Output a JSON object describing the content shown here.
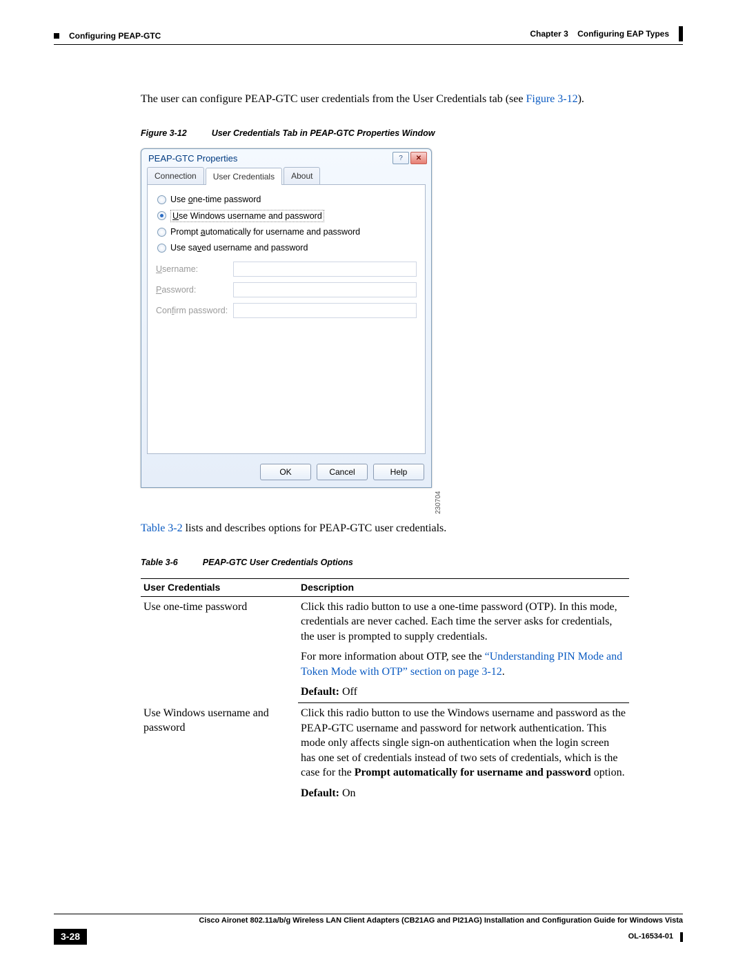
{
  "header": {
    "section": "Configuring PEAP-GTC",
    "chapter_label": "Chapter 3",
    "chapter_title": "Configuring EAP Types"
  },
  "intro": {
    "text_pre": "The user can configure PEAP-GTC user credentials from the User Credentials tab (see ",
    "link": "Figure 3-12",
    "text_post": ")."
  },
  "figure": {
    "label": "Figure 3-12",
    "title": "User Credentials Tab in PEAP-GTC Properties Window",
    "image_number": "230704"
  },
  "dialog": {
    "title": "PEAP-GTC Properties",
    "tabs": {
      "connection": "Connection",
      "user_creds": "User Credentials",
      "about": "About"
    },
    "radios": {
      "otp_pre": "Use ",
      "otp_u": "o",
      "otp_post": "ne-time password",
      "win_pre": "",
      "win_u": "U",
      "win_post": "se Windows username and password",
      "prompt_pre": "Prompt ",
      "prompt_u": "a",
      "prompt_post": "utomatically for username and password",
      "saved_pre": "Use sa",
      "saved_u": "v",
      "saved_post": "ed username and password"
    },
    "fields": {
      "user_pre": "",
      "user_u": "U",
      "user_post": "sername:",
      "pass_pre": "",
      "pass_u": "P",
      "pass_post": "assword:",
      "conf_pre": "Con",
      "conf_u": "f",
      "conf_post": "irm password:"
    },
    "buttons": {
      "ok": "OK",
      "cancel": "Cancel",
      "help": "Help"
    }
  },
  "mid": {
    "link": "Table 3-2",
    "text": " lists and describes options for PEAP-GTC user credentials."
  },
  "table": {
    "label": "Table 3-6",
    "title": "PEAP-GTC User Credentials Options",
    "col1": "User Credentials",
    "col2": "Description",
    "r1_name": "Use one-time password",
    "r1_p1": "Click this radio button to use a one-time password (OTP). In this mode, credentials are never cached. Each time the server asks for credentials, the user is prompted to supply credentials.",
    "r1_p2_pre": "For more information about OTP, see the ",
    "r1_p2_link": "“Understanding PIN Mode and Token Mode with OTP” section on page 3-12",
    "r1_p2_post": ".",
    "r1_def_label": "Default:",
    "r1_def_val": " Off",
    "r2_name": "Use Windows username and password",
    "r2_p1_pre": "Click this radio button to use the Windows username and password as the PEAP-GTC username and password for network authentication. This mode only affects single sign-on authentication when the login screen has one set of credentials instead of two sets of credentials, which is the case for the ",
    "r2_p1_bold": "Prompt automatically for username and password",
    "r2_p1_post": " option.",
    "r2_def_label": "Default:",
    "r2_def_val": " On"
  },
  "footer": {
    "book": "Cisco Aironet 802.11a/b/g Wireless LAN Client Adapters (CB21AG and PI21AG) Installation and Configuration Guide for Windows Vista",
    "page": "3-28",
    "doc": "OL-16534-01"
  }
}
